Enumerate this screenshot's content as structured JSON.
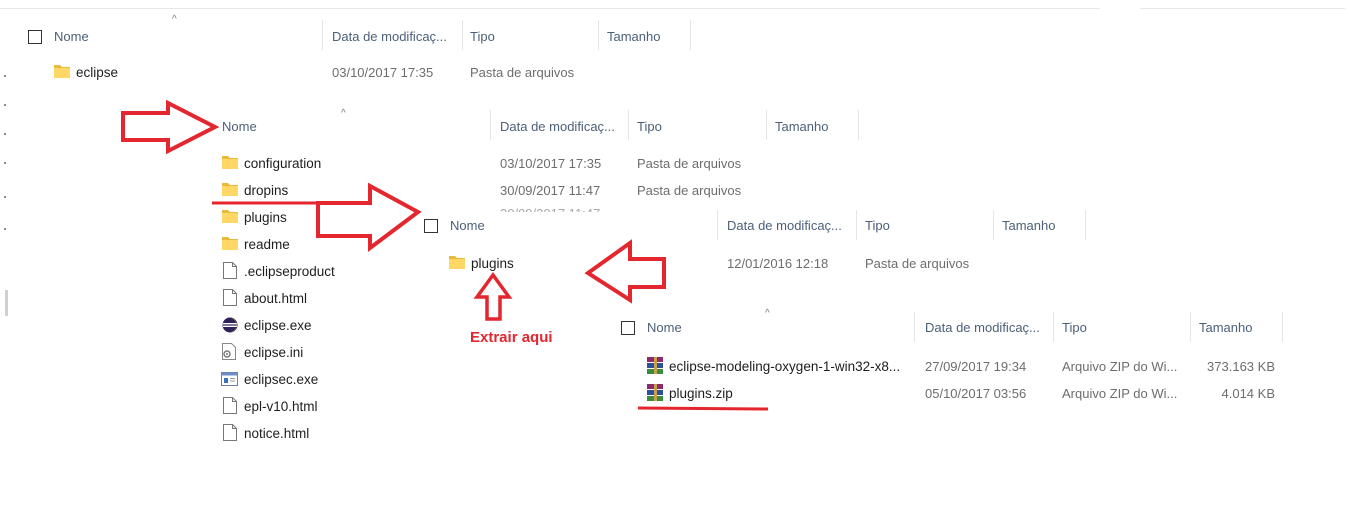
{
  "pane1": {
    "headers": {
      "name": "Nome",
      "modified": "Data de modificaç...",
      "type": "Tipo",
      "size": "Tamanho"
    },
    "rows": [
      {
        "name": "eclipse",
        "icon": "folder-icon",
        "modified": "03/10/2017 17:35",
        "type": "Pasta de arquivos",
        "size": ""
      }
    ]
  },
  "pane2": {
    "headers": {
      "name": "Nome",
      "modified": "Data de modificaç...",
      "type": "Tipo",
      "size": "Tamanho"
    },
    "rows": [
      {
        "name": "configuration",
        "icon": "folder-icon",
        "modified": "03/10/2017 17:35",
        "type": "Pasta de arquivos"
      },
      {
        "name": "dropins",
        "icon": "folder-icon",
        "modified": "30/09/2017 11:47",
        "type": "Pasta de arquivos"
      },
      {
        "name": "plugins",
        "icon": "folder-icon",
        "modified": "",
        "type": ""
      },
      {
        "name": "readme",
        "icon": "folder-icon",
        "modified": "",
        "type": ""
      },
      {
        "name": ".eclipseproduct",
        "icon": "file-icon",
        "modified": "",
        "type": ""
      },
      {
        "name": "about.html",
        "icon": "file-icon",
        "modified": "",
        "type": ""
      },
      {
        "name": "eclipse.exe",
        "icon": "eclipse-logo-icon",
        "modified": "",
        "type": ""
      },
      {
        "name": "eclipse.ini",
        "icon": "settings-file-icon",
        "modified": "",
        "type": ""
      },
      {
        "name": "eclipsec.exe",
        "icon": "console-app-icon",
        "modified": "",
        "type": ""
      },
      {
        "name": "epl-v10.html",
        "icon": "file-icon",
        "modified": "",
        "type": ""
      },
      {
        "name": "notice.html",
        "icon": "file-icon",
        "modified": "",
        "type": ""
      }
    ]
  },
  "pane3": {
    "headers": {
      "name": "Nome",
      "modified": "Data de modificaç...",
      "type": "Tipo",
      "size": "Tamanho"
    },
    "rows": [
      {
        "name": "plugins",
        "icon": "folder-icon",
        "modified": "12/01/2016 12:18",
        "type": "Pasta de arquivos"
      }
    ]
  },
  "pane4": {
    "headers": {
      "name": "Nome",
      "modified": "Data de modificaç...",
      "type": "Tipo",
      "size": "Tamanho"
    },
    "rows": [
      {
        "name": "eclipse-modeling-oxygen-1-win32-x8...",
        "icon": "winrar-archive-icon",
        "modified": "27/09/2017 19:34",
        "type": "Arquivo ZIP do Wi...",
        "size": "373.163 KB"
      },
      {
        "name": "plugins.zip",
        "icon": "winrar-archive-icon",
        "modified": "05/10/2017 03:56",
        "type": "Arquivo ZIP do Wi...",
        "size": "4.014 KB"
      }
    ]
  },
  "annotation": {
    "extract_label": "Extrair aqui"
  },
  "colors": {
    "annotation_red": "#e4262e",
    "folder_yellow": "#ffd766",
    "header_text": "#4c607a",
    "detail_text": "#6d6d6d"
  }
}
